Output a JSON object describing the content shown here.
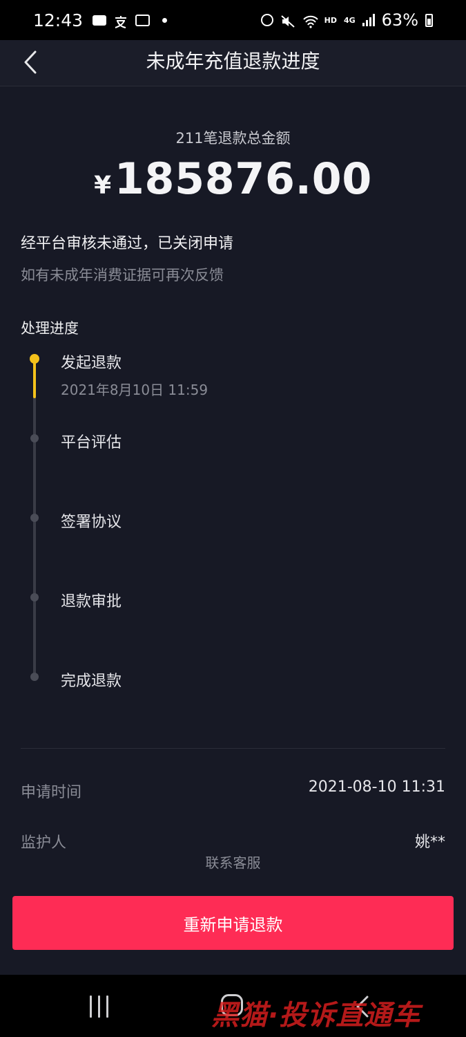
{
  "status_bar": {
    "time": "12:43",
    "hd_label": "HD",
    "network_label": "4G",
    "battery": "63%"
  },
  "header": {
    "title": "未成年充值退款进度"
  },
  "summary": {
    "total_label": "211笔退款总金额",
    "currency": "¥",
    "amount": "185876.00"
  },
  "result": {
    "status": "经平台审核未通过，已关闭申请",
    "hint": "如有未成年消费证据可再次反馈"
  },
  "progress": {
    "section_title": "处理进度",
    "steps": [
      {
        "label": "发起退款",
        "time": "2021年8月10日 11:59",
        "active": true
      },
      {
        "label": "平台评估",
        "time": "",
        "active": false
      },
      {
        "label": "签署协议",
        "time": "",
        "active": false
      },
      {
        "label": "退款审批",
        "time": "",
        "active": false
      },
      {
        "label": "完成退款",
        "time": "",
        "active": false
      }
    ]
  },
  "info": {
    "apply_time_label": "申请时间",
    "apply_time_value": "2021-08-10 11:31",
    "guardian_label": "监护人",
    "guardian_value": "姚**"
  },
  "actions": {
    "contact_label": "联系客服",
    "reapply_label": "重新申请退款"
  },
  "watermark": "黑猫·投诉直通车",
  "colors": {
    "background": "#171925",
    "accent": "#fe2c55",
    "progress_active": "#f5c21b"
  }
}
